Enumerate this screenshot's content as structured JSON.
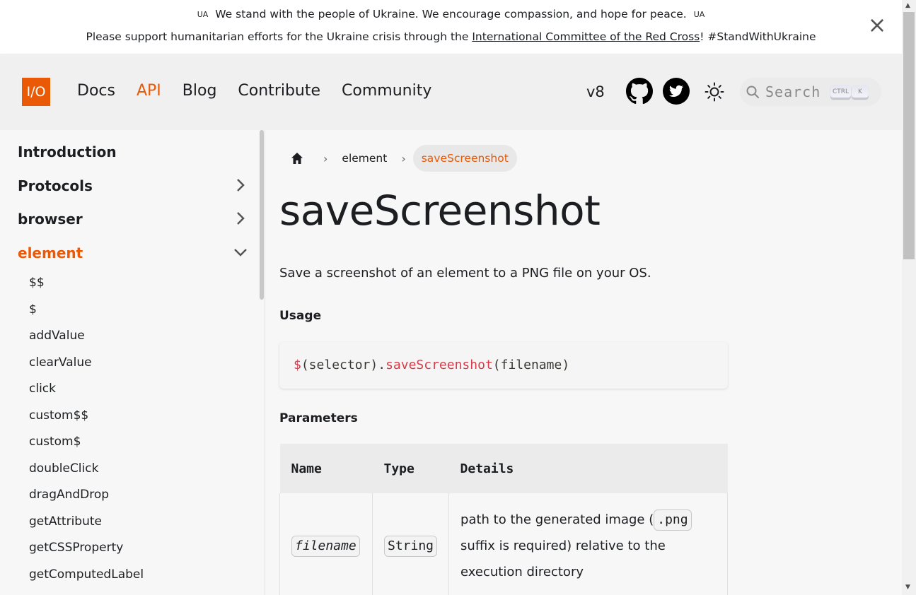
{
  "announcement": {
    "line1_flag_left": "UA",
    "line1_text": "We stand with the people of Ukraine. We encourage compassion, and hope for peace.",
    "line1_flag_right": "UA",
    "line2_before": "Please support humanitarian efforts for the Ukraine crisis through the ",
    "line2_link": "International Committee of the Red Cross",
    "line2_after": "! #StandWithUkraine",
    "close_label": "×"
  },
  "navbar": {
    "logo": "I/O",
    "links": [
      "Docs",
      "API",
      "Blog",
      "Contribute",
      "Community"
    ],
    "active_link": "API",
    "version": "v8",
    "search_placeholder": "Search",
    "search_keys": [
      "CTRL",
      "K"
    ],
    "accent_color": "#ea5906"
  },
  "sidebar": {
    "categories": [
      {
        "label": "Introduction",
        "expandable": false
      },
      {
        "label": "Protocols",
        "expandable": true
      },
      {
        "label": "browser",
        "expandable": true
      },
      {
        "label": "element",
        "expandable": true,
        "expanded": true
      }
    ],
    "items": [
      "$$",
      "$",
      "addValue",
      "clearValue",
      "click",
      "custom$$",
      "custom$",
      "doubleClick",
      "dragAndDrop",
      "getAttribute",
      "getCSSProperty",
      "getComputedLabel"
    ]
  },
  "breadcrumb": {
    "items": [
      "element",
      "saveScreenshot"
    ]
  },
  "page": {
    "title": "saveScreenshot",
    "description": "Save a screenshot of an element to a PNG file on your OS.",
    "usage_heading": "Usage",
    "code": {
      "part1": "$",
      "part2": "(selector).",
      "part3": "saveScreenshot",
      "part4": "(filename)"
    },
    "params_heading": "Parameters",
    "table": {
      "headers": [
        "Name",
        "Type",
        "Details"
      ],
      "rows": [
        {
          "name": "filename",
          "type": "String",
          "details_before": "path to the generated image (",
          "details_code": ".png",
          "details_after": " suffix is required) relative to the execution directory"
        }
      ]
    }
  }
}
